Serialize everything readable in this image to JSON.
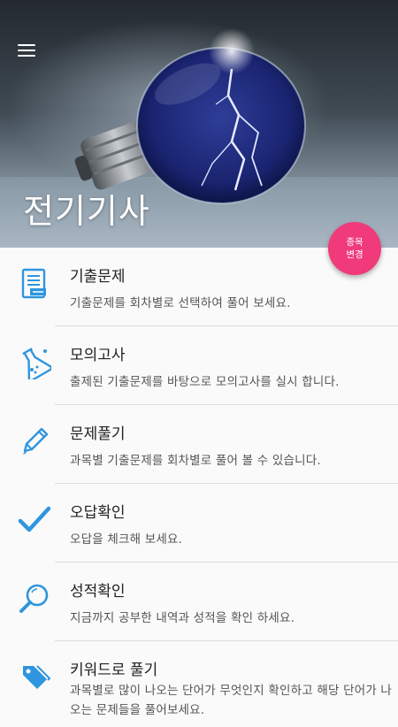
{
  "header": {
    "title": "전기기사",
    "menu_icon": "hamburger-menu-icon",
    "fab_label": "종목\n변경",
    "fab_color": "#f03a7a"
  },
  "menu": {
    "items": [
      {
        "title": "기출문제",
        "desc": "기출문제를 회차별로 선택하여 풀어 보세요.",
        "icon": "document-list-icon"
      },
      {
        "title": "모의고사",
        "desc": "출제된 기출문제를 바탕으로 모의고사를 실시 합니다.",
        "icon": "flask-icon"
      },
      {
        "title": "문제풀기",
        "desc": "과목별 기출문제를 회차별로 풀어 볼 수 있습니다.",
        "icon": "pencil-icon"
      },
      {
        "title": "오답확인",
        "desc": "오답을 체크해 보세요.",
        "icon": "checkmark-icon"
      },
      {
        "title": "성적확인",
        "desc": "지금까지 공부한 내역과 성적을 확인 하세요.",
        "icon": "magnifier-icon"
      },
      {
        "title": "키워드로 풀기",
        "desc": "과목별로 많이 나오는 단어가 무엇인지 확인하고 해당 단어가 나오는 문제들을 풀어보세요.",
        "icon": "tag-icon"
      }
    ]
  },
  "colors": {
    "accent": "#2f95de",
    "fab": "#f03a7a"
  }
}
